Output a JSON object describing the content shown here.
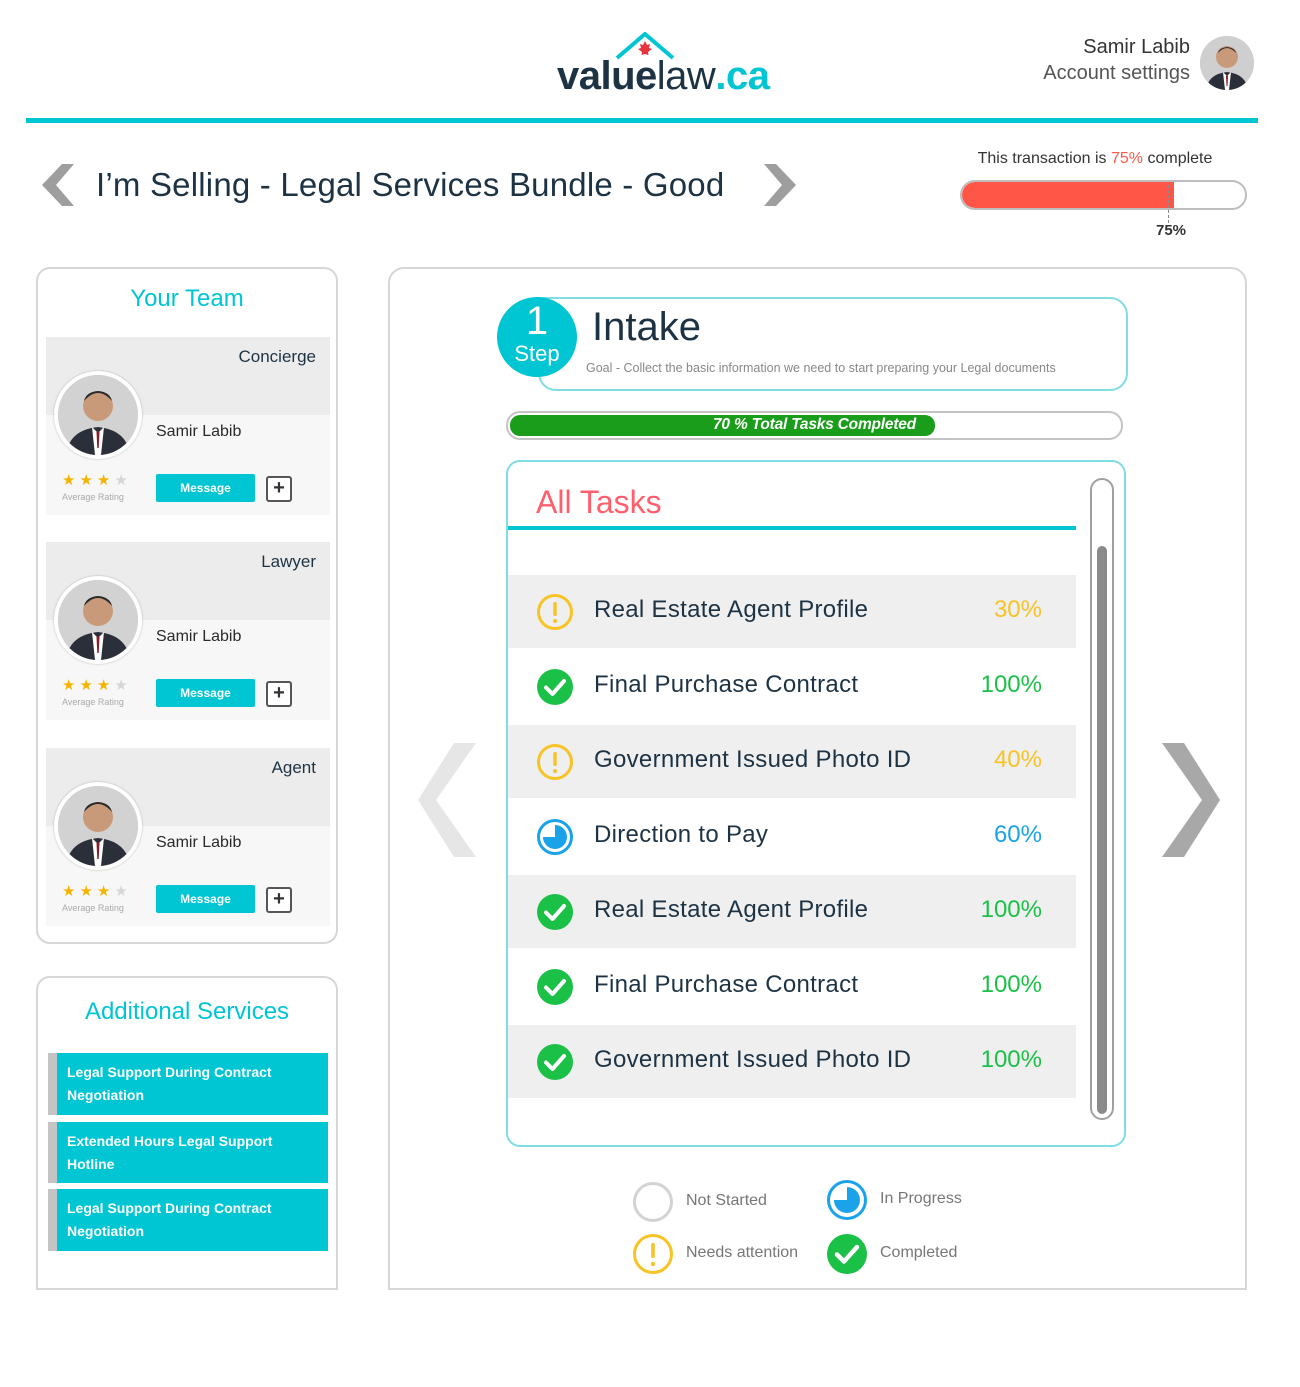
{
  "brand": {
    "logo_value": "value",
    "logo_law": "law",
    "logo_tld": ".ca",
    "accent": "#00c5d3"
  },
  "account": {
    "name": "Samir Labib",
    "settings_label": "Account settings"
  },
  "title": "I’m Selling - Legal Services Bundle - Good",
  "transaction": {
    "label_prefix": "This transaction is ",
    "percent_text": "75%",
    "label_suffix": " complete",
    "value_label": "75%",
    "progress": 0.75,
    "bar_color": "#ff5647"
  },
  "team": {
    "heading": "Your Team",
    "members": [
      {
        "role": "Concierge",
        "name": "Samir Labib",
        "rating": 3,
        "rating_label": "Average Rating",
        "message_label": "Message",
        "add_label": "+"
      },
      {
        "role": "Lawyer",
        "name": "Samir Labib",
        "rating": 3,
        "rating_label": "Average Rating",
        "message_label": "Message",
        "add_label": "+"
      },
      {
        "role": "Agent",
        "name": "Samir Labib",
        "rating": 3,
        "rating_label": "Average Rating",
        "message_label": "Message",
        "add_label": "+"
      }
    ]
  },
  "services": {
    "heading": "Additional Services",
    "items": [
      "Legal Support During Contract Negotiation",
      "Extended Hours Legal Support Hotline",
      "Legal Support During Contract Negotiation"
    ]
  },
  "step": {
    "number": "1",
    "word": "Step",
    "title": "Intake",
    "goal": "Goal - Collect the basic information we need to start preparing your Legal documents",
    "tasks_progress_text": "70 % Total Tasks Completed",
    "tasks_progress": 0.7
  },
  "tasks": {
    "heading": "All Tasks",
    "items": [
      {
        "label": "Real Estate Agent Profile",
        "percent": "30%",
        "status": "needs-attention",
        "icon": "exclamation-icon"
      },
      {
        "label": "Final Purchase Contract",
        "percent": "100%",
        "status": "completed",
        "icon": "check-icon"
      },
      {
        "label": "Government Issued Photo ID",
        "percent": "40%",
        "status": "needs-attention",
        "icon": "exclamation-icon"
      },
      {
        "label": "Direction to Pay",
        "percent": "60%",
        "status": "in-progress",
        "icon": "pie-progress-icon"
      },
      {
        "label": "Real Estate Agent Profile",
        "percent": "100%",
        "status": "completed",
        "icon": "check-icon"
      },
      {
        "label": "Final Purchase Contract",
        "percent": "100%",
        "status": "completed",
        "icon": "check-icon"
      },
      {
        "label": "Government Issued Photo ID",
        "percent": "100%",
        "status": "completed",
        "icon": "check-icon"
      }
    ]
  },
  "legend": {
    "not_started": "Not Started",
    "in_progress": "In Progress",
    "needs_attention": "Needs attention",
    "completed": "Completed"
  },
  "colors": {
    "attention": "#f7c325",
    "completed": "#1bc047",
    "in_progress": "#1aa3e8",
    "not_started": "#d3d3d3",
    "tasks_bar": "#1a9d1a",
    "tasks_heading": "#ff5f6d"
  }
}
